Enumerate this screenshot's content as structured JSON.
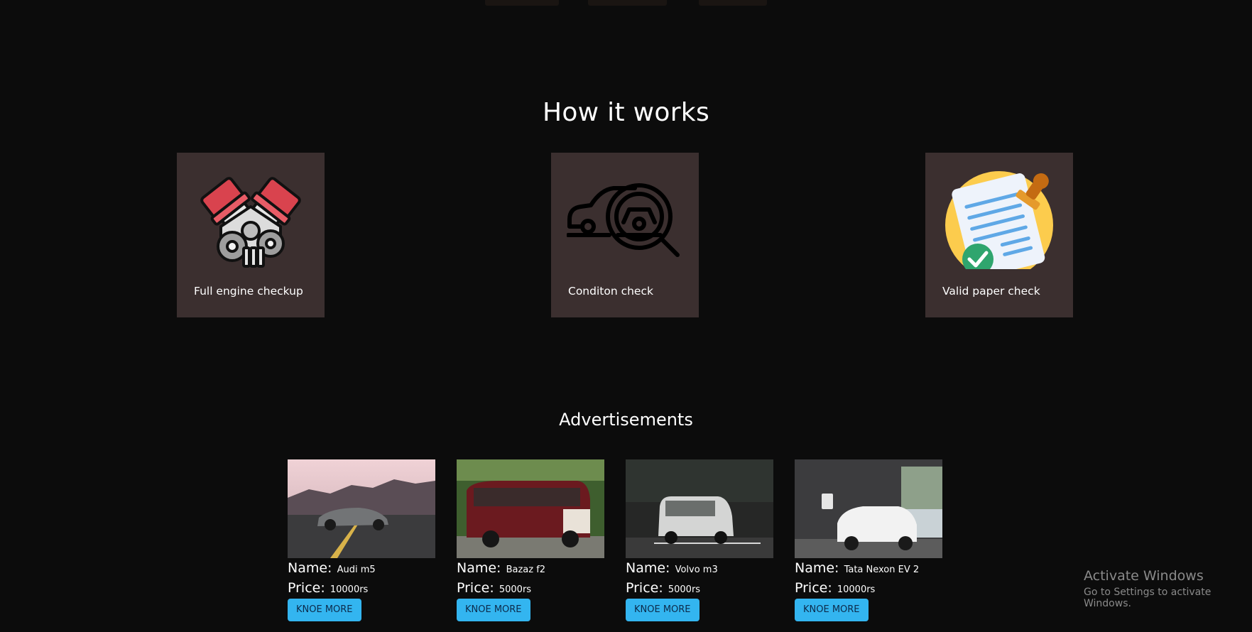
{
  "how_it_works": {
    "title": "How it works",
    "cards": [
      {
        "label": "Full engine checkup",
        "icon": "engine-icon"
      },
      {
        "label": "Conditon check",
        "icon": "car-inspection-icon"
      },
      {
        "label": "Valid paper check",
        "icon": "document-stamp-icon"
      }
    ]
  },
  "advertisements": {
    "title": "Advertisements",
    "name_label": "Name:",
    "price_label": "Price:",
    "button_label": "KNOE MORE",
    "items": [
      {
        "name": "Audi m5",
        "price": "10000rs",
        "photo": "grey-sports-car-photo"
      },
      {
        "name": "Bazaz f2",
        "price": "5000rs",
        "photo": "red-van-photo"
      },
      {
        "name": "Volvo m3",
        "price": "5000rs",
        "photo": "white-minivan-photo"
      },
      {
        "name": "Tata Nexon EV 2",
        "price": "10000rs",
        "photo": "white-ev-charging-photo"
      }
    ]
  },
  "watermark": {
    "title": "Activate Windows",
    "subtitle": "Go to Settings to activate Windows."
  },
  "colors": {
    "background": "#0c0c0c",
    "card": "#3b2f2f",
    "button": "#33b5f0"
  }
}
